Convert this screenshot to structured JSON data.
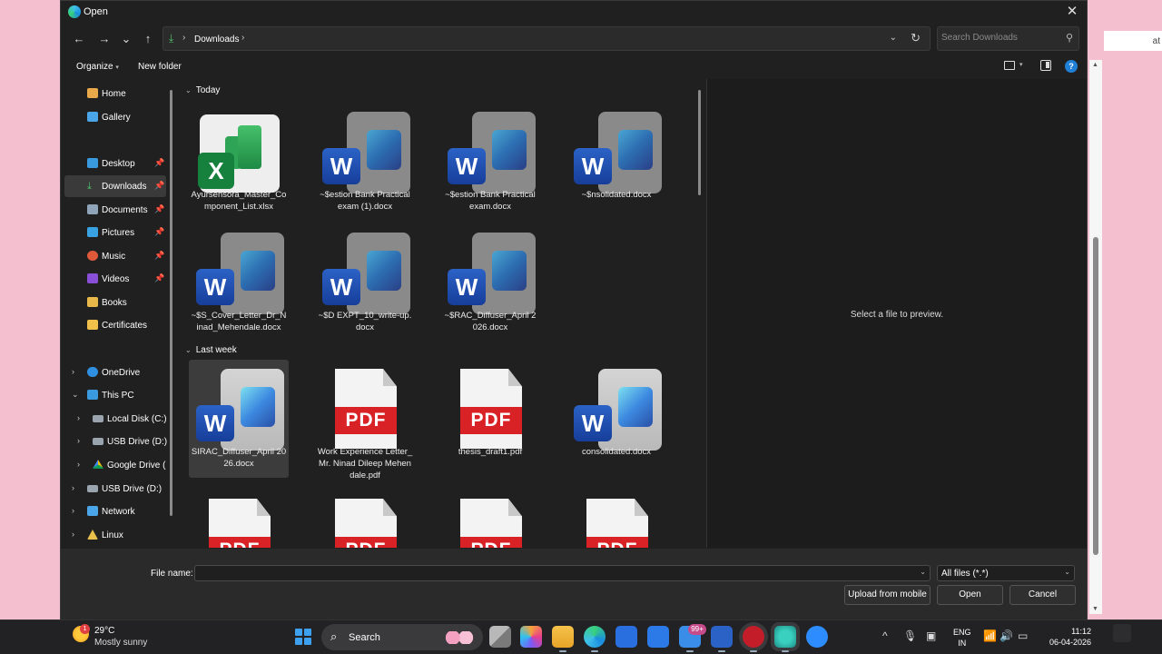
{
  "window": {
    "title": "Open",
    "close_glyph": "✕"
  },
  "nav": {
    "back": "←",
    "forward": "→",
    "recent": "⌄",
    "up": "↑"
  },
  "address": {
    "path": [
      "Downloads"
    ],
    "refresh": "↻"
  },
  "search": {
    "placeholder": "Search Downloads"
  },
  "toolbar": {
    "organize": "Organize",
    "new_folder": "New folder",
    "help": "?"
  },
  "sidebar": {
    "items": [
      {
        "label": "Home",
        "icon": "home-icon"
      },
      {
        "label": "Gallery",
        "icon": "gallery-icon"
      },
      {
        "label": "Desktop",
        "icon": "desktop-icon",
        "pinned": true
      },
      {
        "label": "Downloads",
        "icon": "download-icon",
        "pinned": true,
        "selected": true
      },
      {
        "label": "Documents",
        "icon": "documents-icon",
        "pinned": true
      },
      {
        "label": "Pictures",
        "icon": "pictures-icon",
        "pinned": true
      },
      {
        "label": "Music",
        "icon": "music-icon",
        "pinned": true
      },
      {
        "label": "Videos",
        "icon": "videos-icon",
        "pinned": true
      },
      {
        "label": "Books",
        "icon": "folder-icon"
      },
      {
        "label": "Certificates",
        "icon": "folder-icon"
      },
      {
        "label": "OneDrive",
        "icon": "cloud-icon"
      },
      {
        "label": "This PC",
        "icon": "pc-icon"
      },
      {
        "label": "Local Disk (C:)",
        "icon": "drive-icon"
      },
      {
        "label": "USB Drive (D:)",
        "icon": "usb-icon"
      },
      {
        "label": "Google Drive (",
        "icon": "google-drive-icon"
      },
      {
        "label": "USB Drive (D:)",
        "icon": "usb-icon"
      },
      {
        "label": "Network",
        "icon": "network-icon"
      },
      {
        "label": "Linux",
        "icon": "linux-icon"
      }
    ]
  },
  "groups": [
    {
      "label": "Today"
    },
    {
      "label": "Last week"
    }
  ],
  "files": [
    {
      "name": "Ayursensora_Master_Component_List.xlsx",
      "icon": "excel-file-icon",
      "group": "Today"
    },
    {
      "name": "~$estion Bank Practical exam (1).docx",
      "icon": "word-temp-file-icon",
      "group": "Today"
    },
    {
      "name": "~$estion Bank Practical exam.docx",
      "icon": "word-temp-file-icon",
      "group": "Today"
    },
    {
      "name": "~$nsolidated.docx",
      "icon": "word-temp-file-icon",
      "group": "Today"
    },
    {
      "name": "~$S_Cover_Letter_Dr_Ninad_Mehendale.docx",
      "icon": "word-temp-file-icon",
      "group": "Today"
    },
    {
      "name": "~$D EXPT_10_write-up.docx",
      "icon": "word-temp-file-icon",
      "group": "Today"
    },
    {
      "name": "~$RAC_Diffuser_April 2026.docx",
      "icon": "word-temp-file-icon",
      "group": "Today"
    },
    {
      "name": "SIRAC_Diffuser_April 2026.docx",
      "icon": "word-file-icon",
      "group": "Last week",
      "selected": true
    },
    {
      "name": "Work Experience Letter_Mr. Ninad Dileep Mehendale.pdf",
      "icon": "pdf-file-icon",
      "group": "Last week"
    },
    {
      "name": "thesis_draft1.pdf",
      "icon": "pdf-file-icon",
      "group": "Last week"
    },
    {
      "name": "consolidated.docx",
      "icon": "word-file-icon",
      "group": "Last week"
    },
    {
      "name": "",
      "icon": "pdf-file-icon",
      "group": "Last week"
    },
    {
      "name": "",
      "icon": "pdf-file-icon",
      "group": "Last week"
    },
    {
      "name": "",
      "icon": "pdf-file-icon",
      "group": "Last week"
    },
    {
      "name": "",
      "icon": "pdf-file-icon",
      "group": "Last week"
    }
  ],
  "icon_text": {
    "word": "W",
    "excel": "X",
    "pdf": "PDF"
  },
  "preview": {
    "message": "Select a file to preview."
  },
  "footer": {
    "file_name_label": "File name:",
    "file_name_value": "",
    "file_type": "All files (*.*)",
    "upload_label": "Upload from mobile",
    "open_label": "Open",
    "cancel_label": "Cancel"
  },
  "background": {
    "partial_text": "at"
  },
  "taskbar": {
    "weather_temp": "29°C",
    "weather_desc": "Mostly sunny",
    "weather_badge": "1",
    "search_label": "Search",
    "search_glyph": "⌕",
    "notification_badge": "99+",
    "lang_line1": "ENG",
    "lang_line2": "IN",
    "time": "11:12",
    "date": "06-04-2026",
    "tray_chevron": "^"
  },
  "colors": {
    "accent": "#1f80d6",
    "pdf_red": "#d92226",
    "word_blue": "#2b62c6",
    "excel_green": "#16803d",
    "background_pink": "#f4bfcf"
  }
}
